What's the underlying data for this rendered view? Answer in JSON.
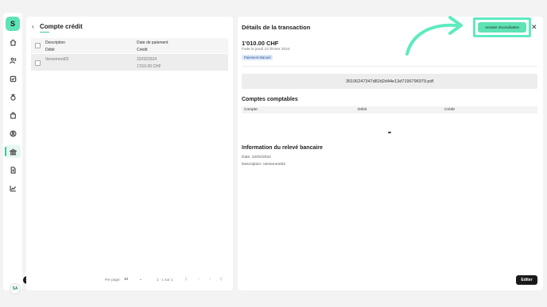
{
  "colors": {
    "accent": "#5ee3b4",
    "highlight": "#5eeac0",
    "dark": "#1a1a1a",
    "tag_bg": "#dce9fb"
  },
  "sidebar": {
    "logo_text": "S",
    "items": [
      {
        "name": "home-icon"
      },
      {
        "name": "people-icon"
      },
      {
        "name": "checklist-icon"
      },
      {
        "name": "money-bag-icon"
      },
      {
        "name": "shopping-bag-icon"
      },
      {
        "name": "user-circle-icon"
      },
      {
        "name": "bank-icon",
        "active": true
      },
      {
        "name": "document-icon"
      },
      {
        "name": "chart-icon"
      }
    ],
    "avatar_initials": "SA",
    "notification_count": "18"
  },
  "left_panel": {
    "back_glyph": "‹",
    "title": "Compte crédit",
    "columns": {
      "description": "Description",
      "debit": "Débit",
      "payment_date": "Date de paiement",
      "credit": "Crédit"
    },
    "rows": [
      {
        "description": "Versement02",
        "date": "22/02/2024",
        "amount": "1'010.00 CHF"
      }
    ],
    "pagination": {
      "per_page_label": "Per page:",
      "per_page_value": "10",
      "range": "1 - 1 sur 1",
      "first": "|‹",
      "prev": "‹",
      "next": "›",
      "last": "›|"
    }
  },
  "right_panel": {
    "title": "Détails de la transaction",
    "cancel_reconciliation_label": "Annuler réconciliation",
    "close_glyph": "✕",
    "amount": "1'010.00 CHF",
    "subtitle": "Faite le jeudi 22 février 2024",
    "tag": "Paiement Manuel",
    "file_name": "35106247347d82d2d44e13d7196796979.pdf",
    "accounts_title": "Comptes comptables",
    "accounts_columns": {
      "account": "Compte",
      "debit": "Débit",
      "credit": "Crédit"
    },
    "bank_info_title": "Information du relevé bancaire",
    "bank_info_date": "Date: 22/02/2024",
    "bank_info_description": "Description: Versement02",
    "edit_label": "Editer"
  }
}
